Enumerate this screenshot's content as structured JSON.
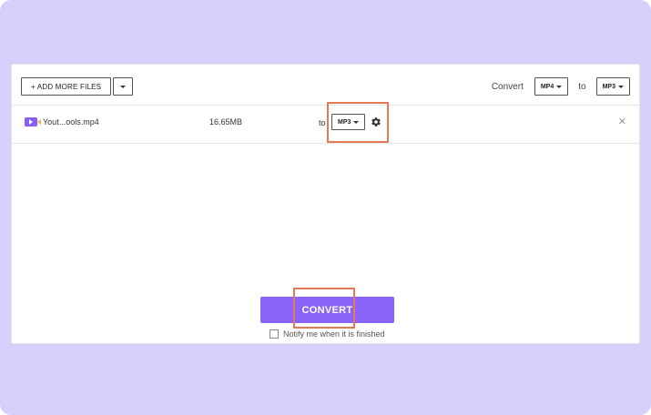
{
  "toolbar": {
    "add_more_files_label": "+ ADD MORE FILES",
    "convert_label": "Convert",
    "from_format": "MP4",
    "to_label": "to",
    "to_format": "MP3"
  },
  "file": {
    "name": "Yout...ools.mp4",
    "size": "16.65MB",
    "to_label": "to",
    "target_format": "MP3"
  },
  "actions": {
    "convert_label": "CONVERT",
    "notify_label": "Notify me when it is finished"
  },
  "colors": {
    "background": "#d7d0fd",
    "accent": "#8a63f8",
    "highlight": "#e47a55"
  },
  "icons": {
    "file_type": "video-file-icon",
    "settings": "gear-icon",
    "remove": "close-icon"
  }
}
